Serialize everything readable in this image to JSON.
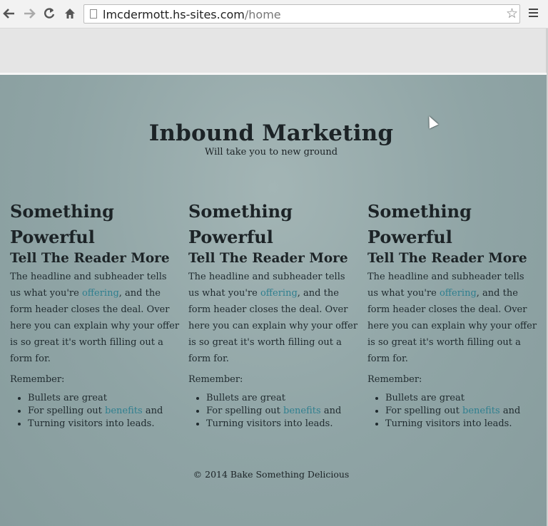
{
  "browser": {
    "url_host": "lmcdermott.hs-sites.com",
    "url_path": "/home"
  },
  "site": {
    "title": "Inbound Marketing",
    "subtitle": "Will take you to new ground"
  },
  "columns": [
    {
      "heading": "Something Powerful",
      "subheading": "Tell The Reader More",
      "body_before": "The headline and subheader tells us what you're ",
      "body_link": "offering",
      "body_after": ", and the form header closes the deal. Over here you can explain why your offer is so great it's worth filling out a form for.",
      "remember": "Remember:",
      "bullet1": "Bullets are great",
      "bullet2_before": "For spelling out ",
      "bullet2_link": "benefits",
      "bullet2_after": " and",
      "bullet3": "Turning visitors into leads."
    },
    {
      "heading": "Something Powerful",
      "subheading": "Tell The Reader More",
      "body_before": "The headline and subheader tells us what you're ",
      "body_link": "offering",
      "body_after": ", and the form header closes the deal. Over here you can explain why your offer is so great it's worth filling out a form for.",
      "remember": "Remember:",
      "bullet1": "Bullets are great",
      "bullet2_before": "For spelling out ",
      "bullet2_link": "benefits",
      "bullet2_after": " and",
      "bullet3": "Turning visitors into leads."
    },
    {
      "heading": "Something Powerful",
      "subheading": "Tell The Reader More",
      "body_before": "The headline and subheader tells us what you're ",
      "body_link": "offering",
      "body_after": ", and the form header closes the deal. Over here you can explain why your offer is so great it's worth filling out a form for.",
      "remember": "Remember:",
      "bullet1": "Bullets are great",
      "bullet2_before": "For spelling out ",
      "bullet2_link": "benefits",
      "bullet2_after": " and",
      "bullet3": "Turning visitors into leads."
    }
  ],
  "footer": {
    "copyright": "© 2014 Bake Something Delicious"
  },
  "colors": {
    "link": "#2f7f8f",
    "page_background": "#97abab",
    "text": "#1c2326"
  }
}
